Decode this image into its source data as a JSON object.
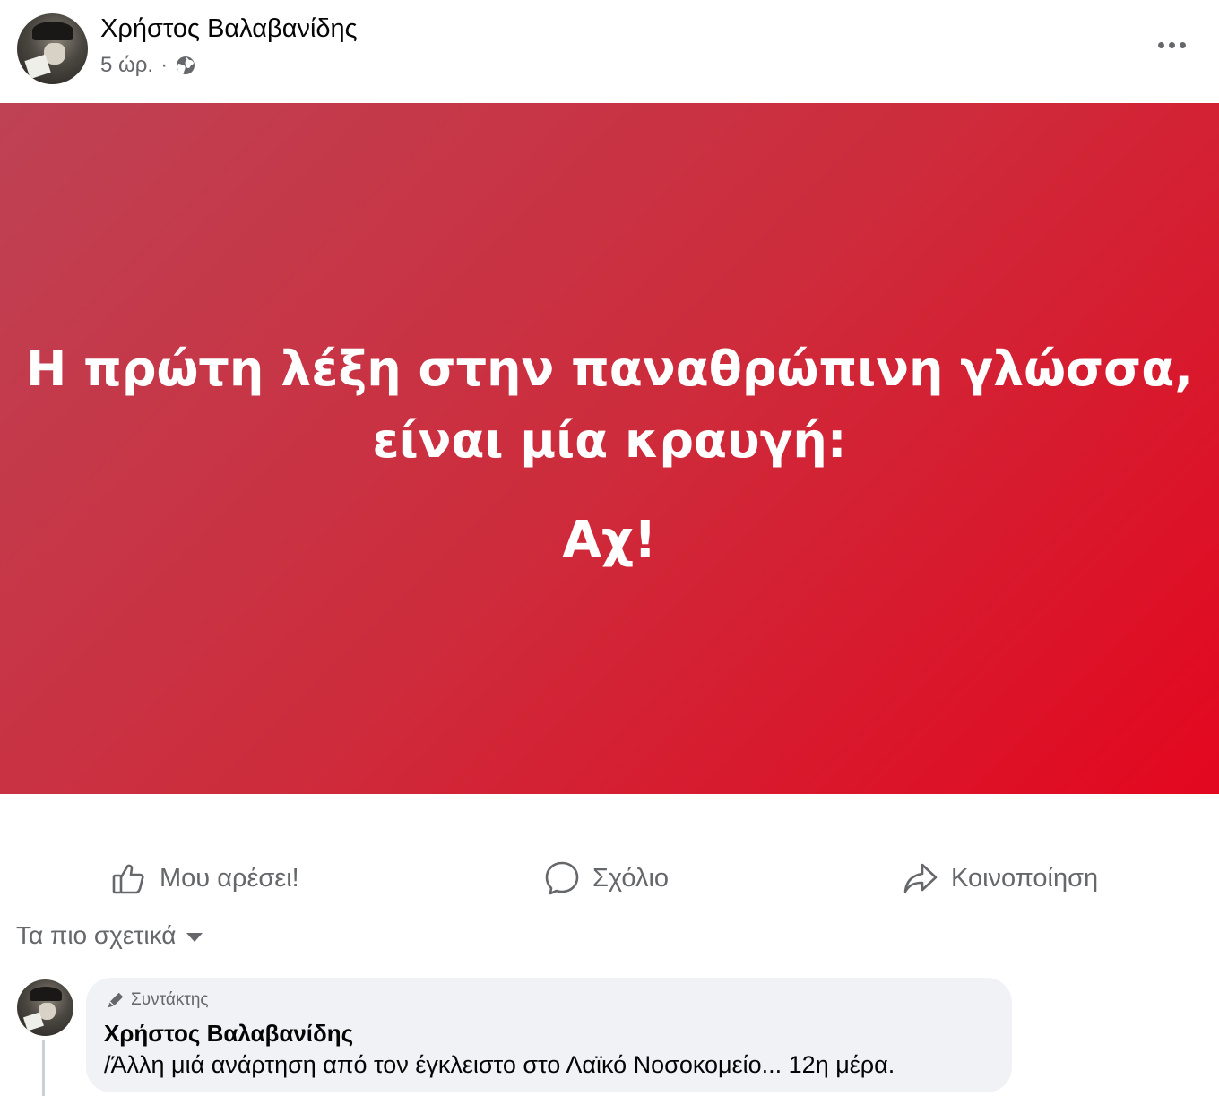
{
  "post": {
    "author": "Χρήστος Βαλαβανίδης",
    "time": "5 ώρ.",
    "separator": "·",
    "audience_icon": "globe-icon",
    "more_icon": "more-horizontal-icon"
  },
  "banner": {
    "background_colors": [
      "#be4254",
      "#e3071f"
    ],
    "line1": "Η πρώτη λέξη στην παναθρώπινη γλώσσα,",
    "line2": "είναι μία κραυγή:",
    "line3": "Αχ!"
  },
  "actions": {
    "like_label": "Μου αρέσει!",
    "comment_label": "Σχόλιο",
    "share_label": "Κοινοποίηση"
  },
  "comments_section": {
    "sort_label": "Τα πιο σχετικά",
    "comments": [
      {
        "badge": "Συντάκτης",
        "author": "Χρήστος Βαλαβανίδης",
        "text": "/Άλλη μιά ανάρτηση από τον έγκλειστο στο Λαϊκό Νοσοκομείο... 12η μέρα."
      }
    ]
  }
}
